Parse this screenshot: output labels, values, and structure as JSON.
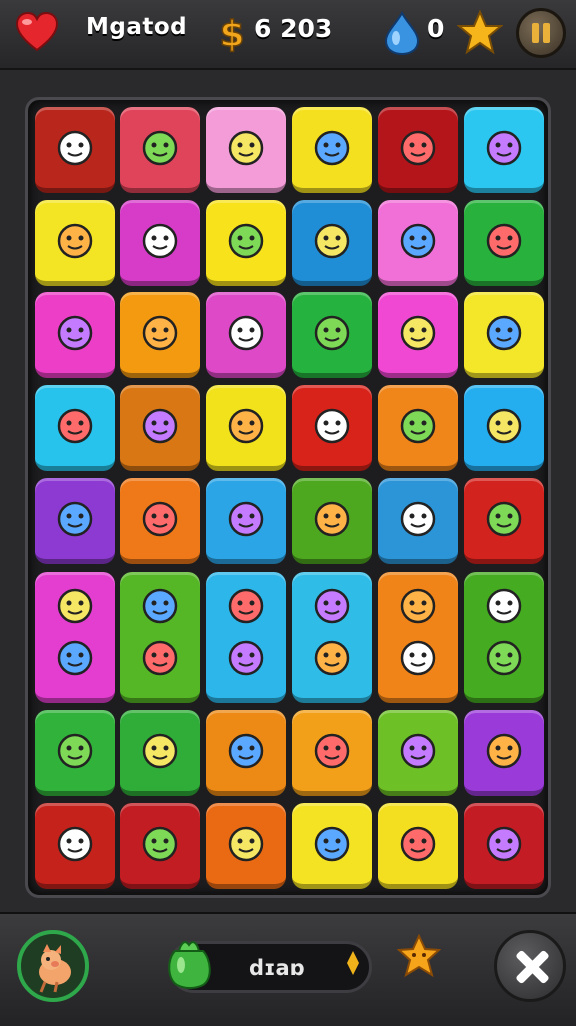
{
  "header": {
    "title": "Mgatod",
    "currency_symbol": "$",
    "coins": "6 203",
    "gems": "0",
    "icons": [
      "heart-icon",
      "dollar-icon",
      "water-drop-icon",
      "star-icon",
      "pause-icon"
    ]
  },
  "board": {
    "columns": 6,
    "tiles": [
      {
        "color": "#b8261c",
        "icon": "bowl-icon"
      },
      {
        "color": "#e0445a",
        "icon": "bread-icon"
      },
      {
        "color": "#f39cd8",
        "icon": "jar-icon"
      },
      {
        "color": "#f5e020",
        "icon": "chili-icon"
      },
      {
        "color": "#b3151a",
        "icon": "mug-icon"
      },
      {
        "color": "#2cc7f0",
        "icon": "star-face-icon"
      },
      {
        "color": "#f3e523",
        "icon": "leaf-drop-icon"
      },
      {
        "color": "#d63cc7",
        "icon": "bottle-icon"
      },
      {
        "color": "#f7e21b",
        "icon": "ring-icon"
      },
      {
        "color": "#1f8ed6",
        "icon": "strawberry-icon"
      },
      {
        "color": "#f170d7",
        "icon": "eye-icon"
      },
      {
        "color": "#29b13d",
        "icon": "fish-icon"
      },
      {
        "color": "#ed3ec7",
        "icon": "book-icon"
      },
      {
        "color": "#f39a11",
        "icon": "pear-icon"
      },
      {
        "color": "#de49c8",
        "icon": "robot-icon"
      },
      {
        "color": "#26b23e",
        "icon": "mushroom-face-icon"
      },
      {
        "color": "#f048d3",
        "icon": "potion-icon"
      },
      {
        "color": "#f4e628",
        "icon": "robot-face-icon"
      },
      {
        "color": "#27c3ec",
        "icon": "lemon-face-icon"
      },
      {
        "color": "#d97714",
        "icon": "purple-face-icon"
      },
      {
        "color": "#f1e21c",
        "icon": "green-face-icon"
      },
      {
        "color": "#d8231a",
        "icon": "blue-face-icon"
      },
      {
        "color": "#f0851a",
        "icon": "cupcake-icon"
      },
      {
        "color": "#24aef0",
        "icon": "lemon-icon"
      },
      {
        "color": "#8d3ad2",
        "icon": "pencil-icon"
      },
      {
        "color": "#ef7918",
        "icon": "flower-icon"
      },
      {
        "color": "#2ba5e6",
        "icon": "onion-icon"
      },
      {
        "color": "#4ea81f",
        "icon": "crossed-sticks-icon"
      },
      {
        "color": "#2b95d8",
        "icon": "jar-icon"
      },
      {
        "color": "#d3231e",
        "icon": "watering-can-icon"
      },
      {
        "color": "#e33ed0",
        "icon": "heart-bell-icon",
        "tall": true
      },
      {
        "color": "#55b725",
        "icon": "lemon-leaf-icon",
        "tall": true
      },
      {
        "color": "#2cb6ea",
        "icon": "drop-lemon-icon",
        "tall": true
      },
      {
        "color": "#2fbde8",
        "icon": "apple-chili-icon",
        "tall": true
      },
      {
        "color": "#f08418",
        "icon": "heart-sun-icon",
        "tall": true
      },
      {
        "color": "#45ab21",
        "icon": "star-banana-icon",
        "tall": true
      },
      {
        "color": "#31b23b",
        "icon": "grapes-icon"
      },
      {
        "color": "#2fad38",
        "icon": "pencil-icon"
      },
      {
        "color": "#ed8a16",
        "icon": "box-face-icon"
      },
      {
        "color": "#f2a01a",
        "icon": "bunny-icon"
      },
      {
        "color": "#6dc126",
        "icon": "pear-icon"
      },
      {
        "color": "#9a3bd9",
        "icon": "pencil-icon"
      },
      {
        "color": "#c5221c",
        "icon": "sad-face-icon"
      },
      {
        "color": "#c21d22",
        "icon": "camera-icon"
      },
      {
        "color": "#ea6a14",
        "icon": "pencil-icon"
      },
      {
        "color": "#f4e323",
        "icon": "purple-face-icon"
      },
      {
        "color": "#f3df1f",
        "icon": "star-face-icon"
      },
      {
        "color": "#c41c24",
        "icon": "blue-star-icon"
      }
    ]
  },
  "footer": {
    "avatar_icon": "pig-icon",
    "bag_icon": "bag-icon",
    "label": "dɪaɒ",
    "arrow_icon": "arrow-icon",
    "star_icon": "star-icon",
    "close_icon": "close-icon"
  }
}
